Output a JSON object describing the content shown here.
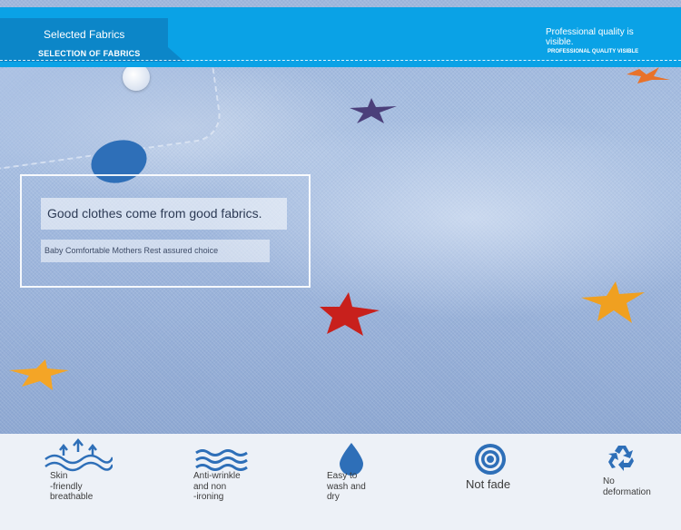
{
  "header": {
    "title": "Selected Fabrics",
    "subtitle": "SELECTION OF FABRICS",
    "tagline": "Professional quality is visible.",
    "tagline_sub": "PROFESSIONAL QUALITY VISIBLE"
  },
  "intro": {
    "headline": "Good clothes come from good fabrics.",
    "subline": "Baby Comfortable Mothers Rest assured choice"
  },
  "features": [
    {
      "icon": "breathable-arrows-icon",
      "label": "Skin\n-friendly\nbreathable"
    },
    {
      "icon": "waves-icon",
      "label": "Anti-wrinkle\nand non\n-ironing"
    },
    {
      "icon": "water-drop-icon",
      "label": "Easy to\nwash and\ndry"
    },
    {
      "icon": "target-icon",
      "label": "Not fade"
    },
    {
      "icon": "recycle-icon",
      "label": "No\ndeformation"
    }
  ],
  "colors": {
    "header_band": "#0aa2e6",
    "header_tab": "#0c86c8",
    "icon_blue": "#2e6fb8",
    "star_red": "#c8201c",
    "star_orange": "#f0a020",
    "star_purple": "#4b3f7a"
  }
}
